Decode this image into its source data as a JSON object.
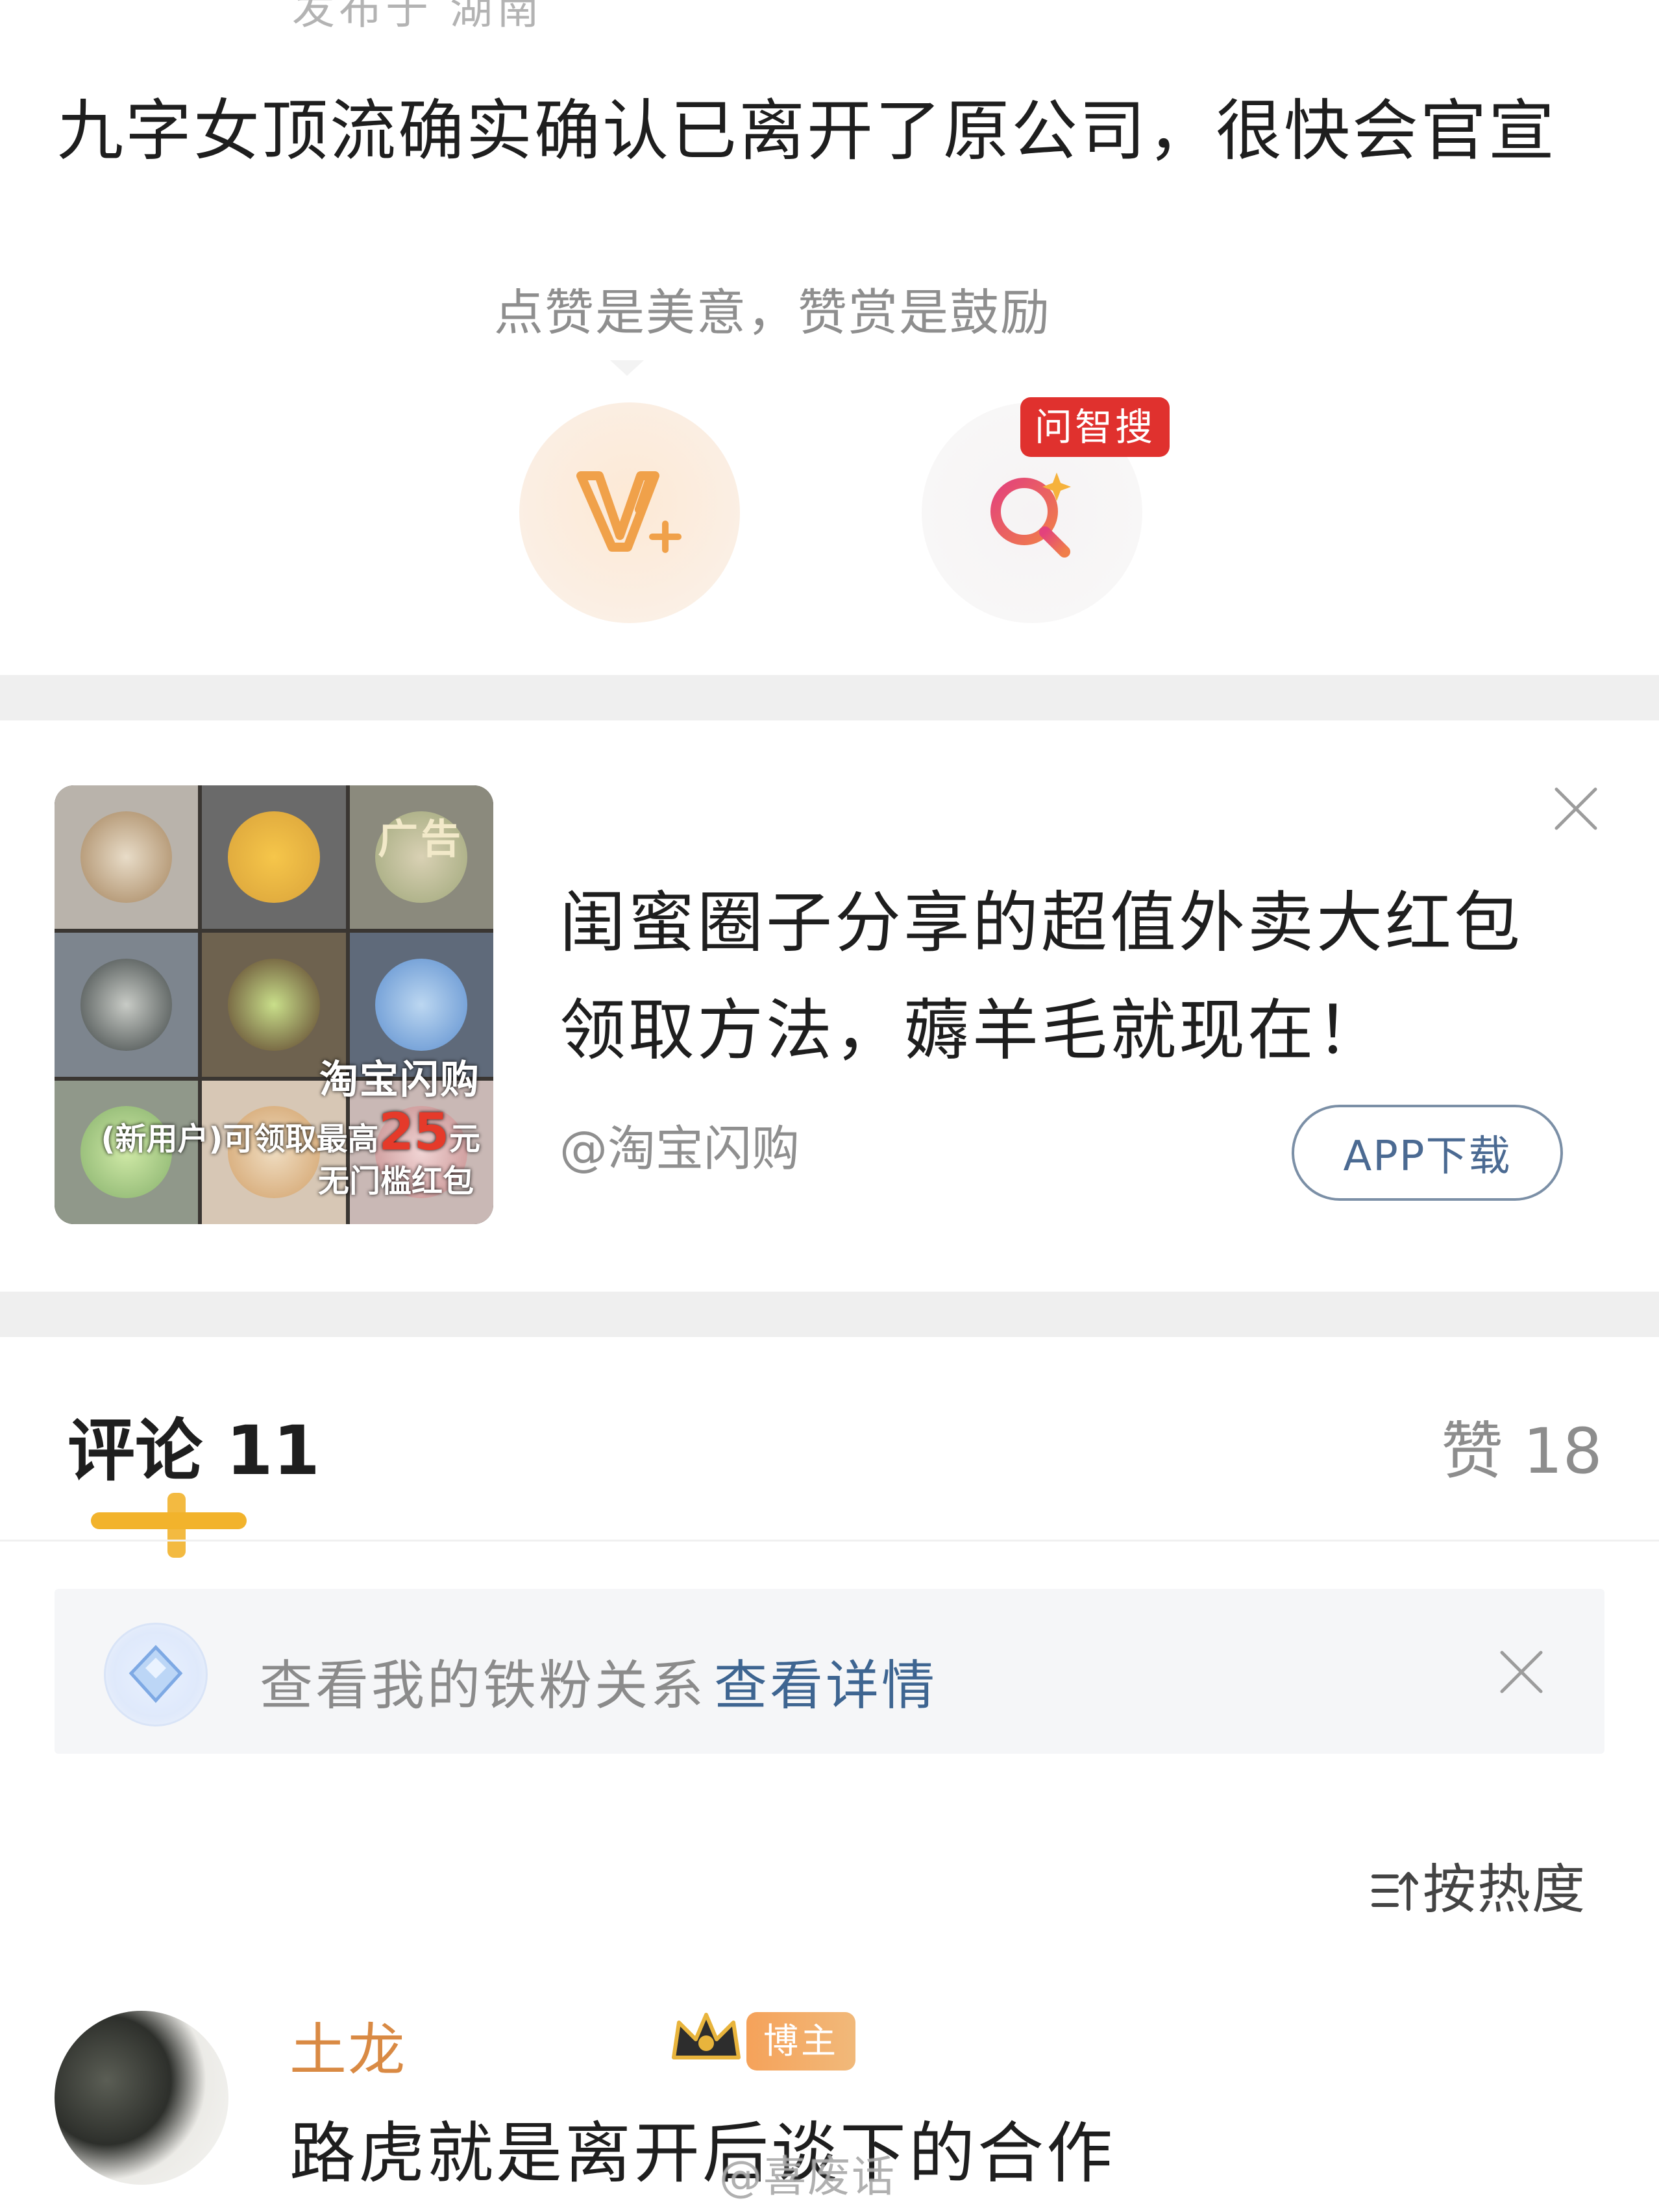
{
  "post": {
    "published_partial": "发布于 湖南",
    "text": "九字女顶流确实确认已离开了原公司，很快会官宣"
  },
  "reward": {
    "hint": "点赞是美意，赞赏是鼓励",
    "search_badge": "问智搜"
  },
  "ad": {
    "tag": "广告",
    "image_brand": "淘宝闪购",
    "image_promo_prefix": "(新用户)可领取最高",
    "image_promo_amount": "25",
    "image_promo_suffix": "元",
    "image_promo_line2": "无门槛红包",
    "title": "闺蜜圈子分享的超值外卖大红包领取方法，薅羊毛就现在！",
    "source": "@淘宝闪购",
    "download_label": "APP下载"
  },
  "comments_header": {
    "comments_label": "评论 11",
    "likes_label": "赞 18"
  },
  "fan_bar": {
    "text": "查看我的铁粉关系",
    "link": "查看详情"
  },
  "sort": {
    "icon": "sort-icon",
    "label": "按热度"
  },
  "comment": {
    "author_visible": "土龙",
    "role_badge": "博主",
    "body": "路虎就是离开后谈下的合作"
  },
  "watermark": "@喜废话",
  "colors": {
    "accent_yellow": "#f2b32c",
    "link_blue": "#3e6591",
    "badge_red": "#e0312e",
    "author_orange": "#d98a44"
  }
}
